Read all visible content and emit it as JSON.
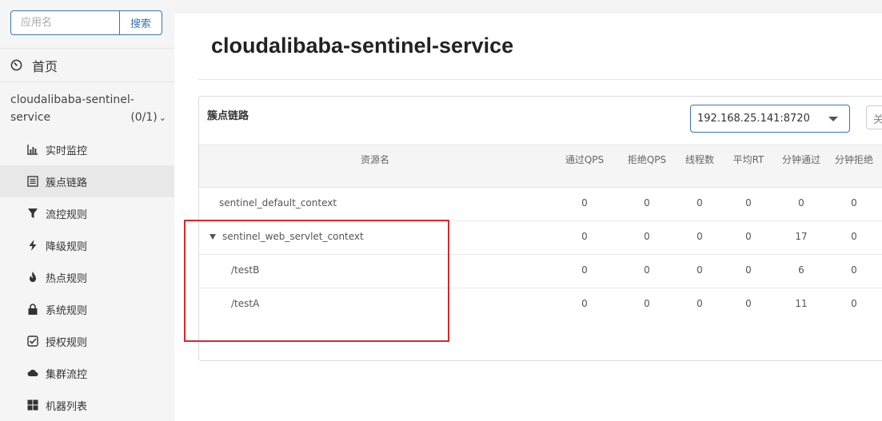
{
  "search": {
    "placeholder": "应用名",
    "button_label": "搜索"
  },
  "sidebar": {
    "home_label": "首页",
    "app_name_line1": "cloudalibaba-sentinel-",
    "app_name_line2": "service",
    "app_count": "(0/1)",
    "items": [
      {
        "label": "实时监控",
        "icon": "bar-chart-icon"
      },
      {
        "label": "簇点链路",
        "icon": "list-icon"
      },
      {
        "label": "流控规则",
        "icon": "filter-icon"
      },
      {
        "label": "降级规则",
        "icon": "flash-icon"
      },
      {
        "label": "热点规则",
        "icon": "fire-icon"
      },
      {
        "label": "系统规则",
        "icon": "lock-icon"
      },
      {
        "label": "授权规则",
        "icon": "check-square-icon"
      },
      {
        "label": "集群流控",
        "icon": "cloud-icon"
      },
      {
        "label": "机器列表",
        "icon": "th-large-icon"
      }
    ]
  },
  "main": {
    "title": "cloudalibaba-sentinel-service",
    "panel_title": "簇点链路",
    "machine_select": "192.168.25.141:8720",
    "partial_button": "关",
    "columns": [
      "资源名",
      "通过QPS",
      "拒绝QPS",
      "线程数",
      "平均RT",
      "分钟通过",
      "分钟拒绝"
    ],
    "rows": [
      {
        "name": "sentinel_default_context",
        "pass_qps": "0",
        "block_qps": "0",
        "threads": "0",
        "avg_rt": "0",
        "minute_pass": "0",
        "minute_block": "0"
      },
      {
        "name": "sentinel_web_servlet_context",
        "pass_qps": "0",
        "block_qps": "0",
        "threads": "0",
        "avg_rt": "0",
        "minute_pass": "17",
        "minute_block": "0"
      },
      {
        "name": "/testB",
        "pass_qps": "0",
        "block_qps": "0",
        "threads": "0",
        "avg_rt": "0",
        "minute_pass": "6",
        "minute_block": "0"
      },
      {
        "name": "/testA",
        "pass_qps": "0",
        "block_qps": "0",
        "threads": "0",
        "avg_rt": "0",
        "minute_pass": "11",
        "minute_block": "0"
      }
    ]
  },
  "colors": {
    "accent": "#3a73b8",
    "highlight": "#d9272e",
    "sidebar_bg": "#f5f5f5"
  }
}
